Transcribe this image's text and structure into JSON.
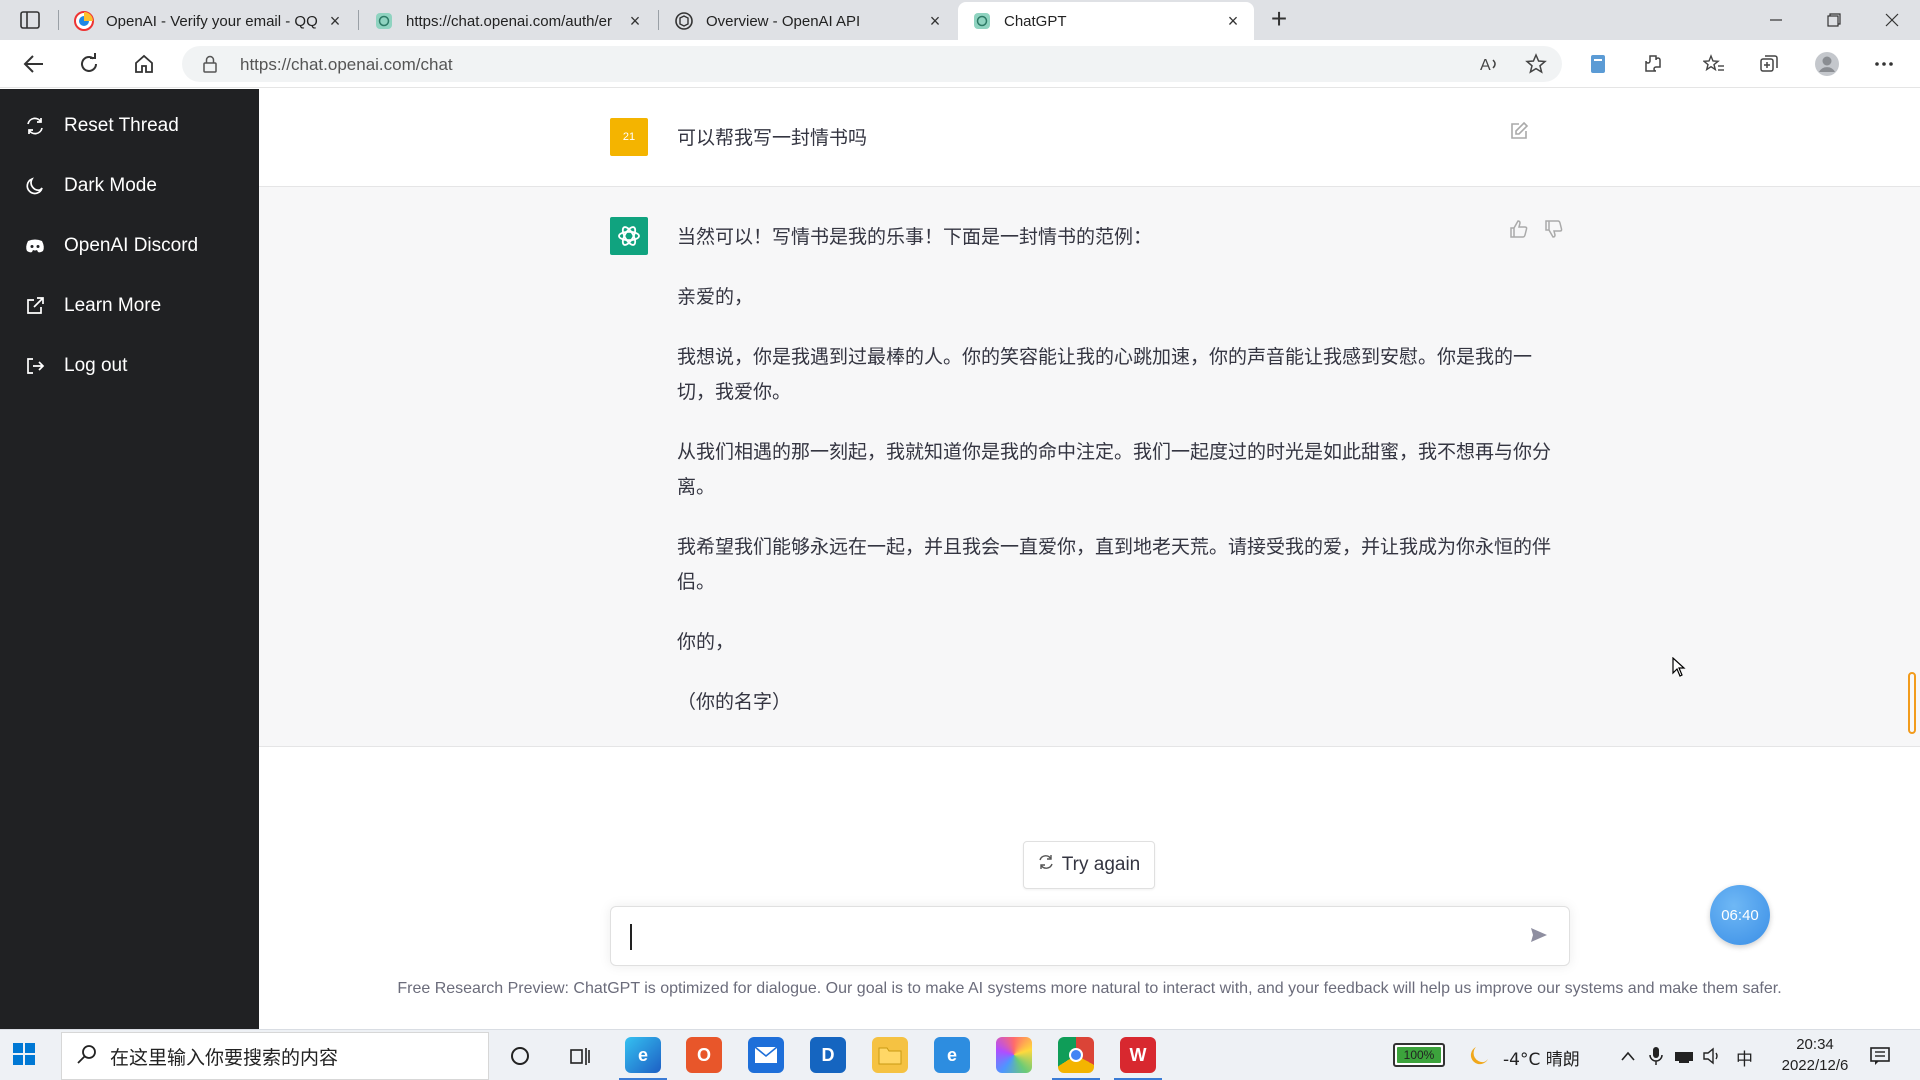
{
  "browser": {
    "tabs": [
      {
        "title": "OpenAI - Verify your email - QQ",
        "favicon": "qq-mail-icon"
      },
      {
        "title": "https://chat.openai.com/auth/er",
        "favicon": "openai-icon"
      },
      {
        "title": "Overview - OpenAI API",
        "favicon": "openai-icon"
      },
      {
        "title": "ChatGPT",
        "favicon": "openai-icon",
        "active": true
      }
    ],
    "url": "https://chat.openai.com/chat"
  },
  "sidebar": {
    "items": [
      {
        "label": "Reset Thread",
        "icon": "reset-icon"
      },
      {
        "label": "Dark Mode",
        "icon": "moon-icon"
      },
      {
        "label": "OpenAI Discord",
        "icon": "discord-icon"
      },
      {
        "label": "Learn More",
        "icon": "external-link-icon"
      },
      {
        "label": "Log out",
        "icon": "logout-icon"
      }
    ]
  },
  "conversation": {
    "user_avatar_text": "21",
    "user_message": "可以帮我写一封情书吗",
    "bot_paragraphs": [
      "当然可以！写情书是我的乐事！下面是一封情书的范例：",
      "亲爱的，",
      "我想说，你是我遇到过最棒的人。你的笑容能让我的心跳加速，你的声音能让我感到安慰。你是我的一切，我爱你。",
      "从我们相遇的那一刻起，我就知道你是我的命中注定。我们一起度过的时光是如此甜蜜，我不想再与你分离。",
      "我希望我们能够永远在一起，并且我会一直爱你，直到地老天荒。请接受我的爱，并让我成为你永恒的伴侣。",
      "你的，",
      "（你的名字）"
    ]
  },
  "actions": {
    "try_again_label": "Try again"
  },
  "composer": {
    "value": ""
  },
  "disclaimer": "Free Research Preview: ChatGPT is optimized for dialogue. Our goal is to make AI systems more natural to interact with, and your feedback will help us improve our systems and make them safer.",
  "overlay": {
    "timer": "06:40"
  },
  "taskbar": {
    "search_placeholder": "在这里输入你要搜索的内容",
    "battery": "100%",
    "battery_level": 1.0,
    "weather": "-4°C 晴朗",
    "ime": "中",
    "time": "20:34",
    "date": "2022/12/6"
  },
  "colors": {
    "sidebar_bg": "#202123",
    "bot_bg": "#f7f7f8",
    "openai_green": "#10a37f",
    "user_avatar": "#f4b400"
  }
}
